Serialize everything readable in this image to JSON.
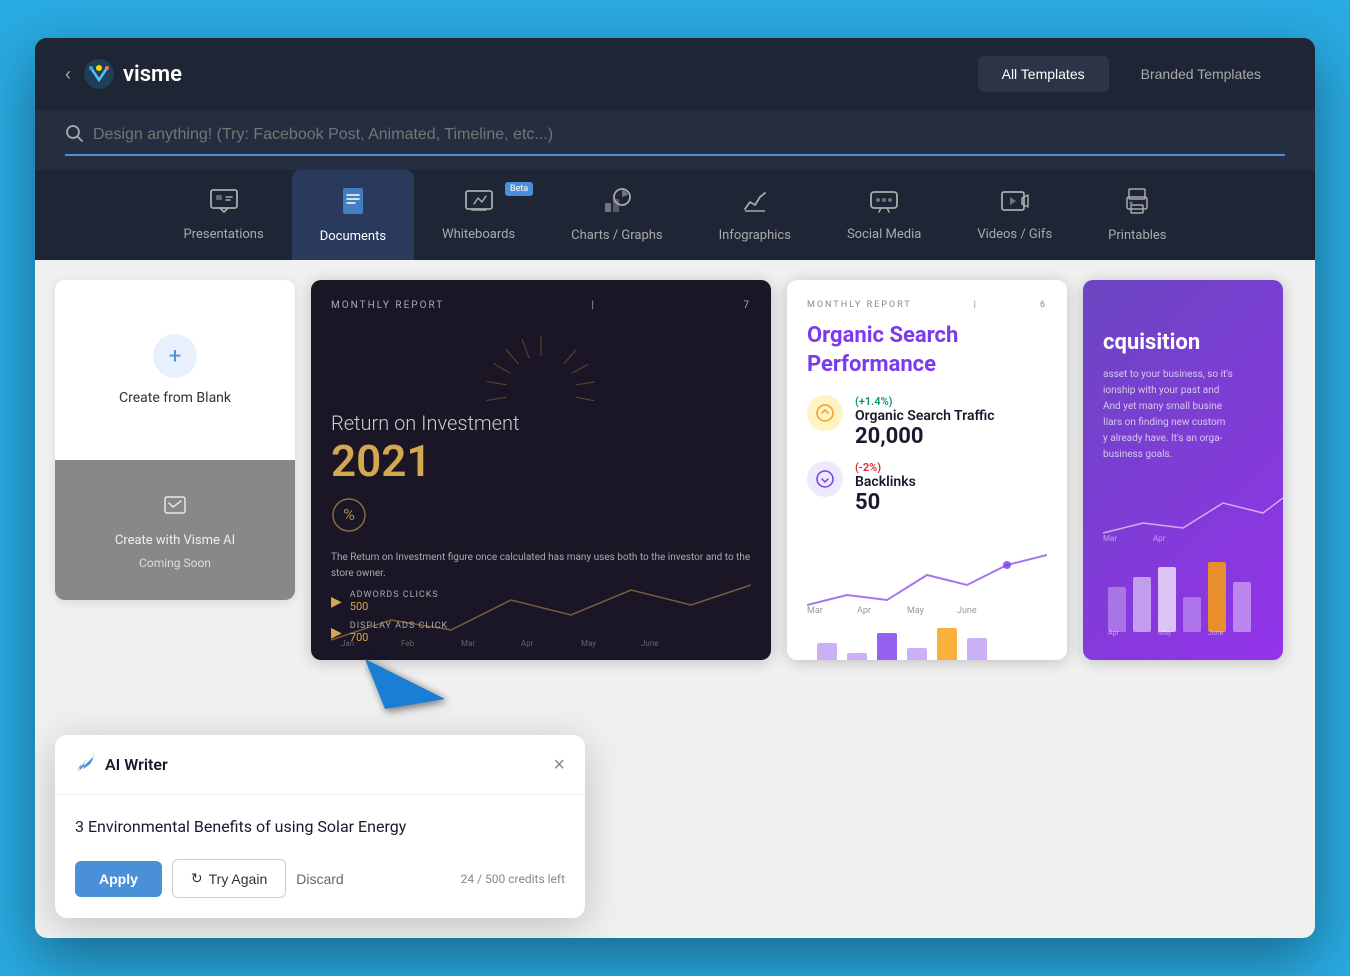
{
  "app": {
    "title": "visme",
    "back_label": "‹"
  },
  "header": {
    "tabs": [
      {
        "id": "all",
        "label": "All Templates",
        "active": true
      },
      {
        "id": "branded",
        "label": "Branded Templates",
        "active": false
      }
    ]
  },
  "search": {
    "placeholder": "Design anything! (Try: Facebook Post, Animated, Timeline, etc...)"
  },
  "categories": [
    {
      "id": "presentations",
      "label": "Presentations",
      "icon": "🖥",
      "active": false,
      "beta": false
    },
    {
      "id": "documents",
      "label": "Documents",
      "icon": "📄",
      "active": true,
      "beta": false
    },
    {
      "id": "whiteboards",
      "label": "Whiteboards",
      "icon": "✏️",
      "active": false,
      "beta": true
    },
    {
      "id": "charts",
      "label": "Charts / Graphs",
      "icon": "📊",
      "active": false,
      "beta": false
    },
    {
      "id": "infographics",
      "label": "Infographics",
      "icon": "📈",
      "active": false,
      "beta": false
    },
    {
      "id": "social",
      "label": "Social Media",
      "icon": "💬",
      "active": false,
      "beta": false
    },
    {
      "id": "videos",
      "label": "Videos / Gifs",
      "icon": "▶️",
      "active": false,
      "beta": false
    },
    {
      "id": "printables",
      "label": "Printables",
      "icon": "🖨",
      "active": false,
      "beta": false
    }
  ],
  "create_blank": {
    "label": "Create from Blank",
    "ai_label": "Create with Visme AI",
    "coming_soon": "Coming Soon"
  },
  "templates": {
    "card1": {
      "header": "MONTHLY REPORT",
      "page": "7",
      "title": "Return on Investment",
      "year": "2021",
      "description": "The Return on Investment figure once calculated has many uses both to the investor and to the store owner.",
      "adwords_label": "ADWORDS CLICKS",
      "adwords_value": "500",
      "display_label": "DISPLAY ADS CLICK",
      "display_value": "700"
    },
    "card2": {
      "header": "MONTHLY REPORT",
      "page": "6",
      "title": "Organic Search Performance",
      "metric1_badge": "(+1.4%)",
      "metric1_label": "Organic Search Traffic",
      "metric1_value": "20,000",
      "metric2_badge": "(-2%)",
      "metric2_label": "Backlinks",
      "metric2_value": "50"
    },
    "card3": {
      "title": "cquisition"
    }
  },
  "ai_writer": {
    "title": "AI Writer",
    "generated_text": "3 Environmental Benefits of using Solar Energy",
    "apply_label": "Apply",
    "try_again_label": "Try Again",
    "discard_label": "Discard",
    "credits_used": "24",
    "credits_total": "500",
    "credits_label": "credits left"
  }
}
